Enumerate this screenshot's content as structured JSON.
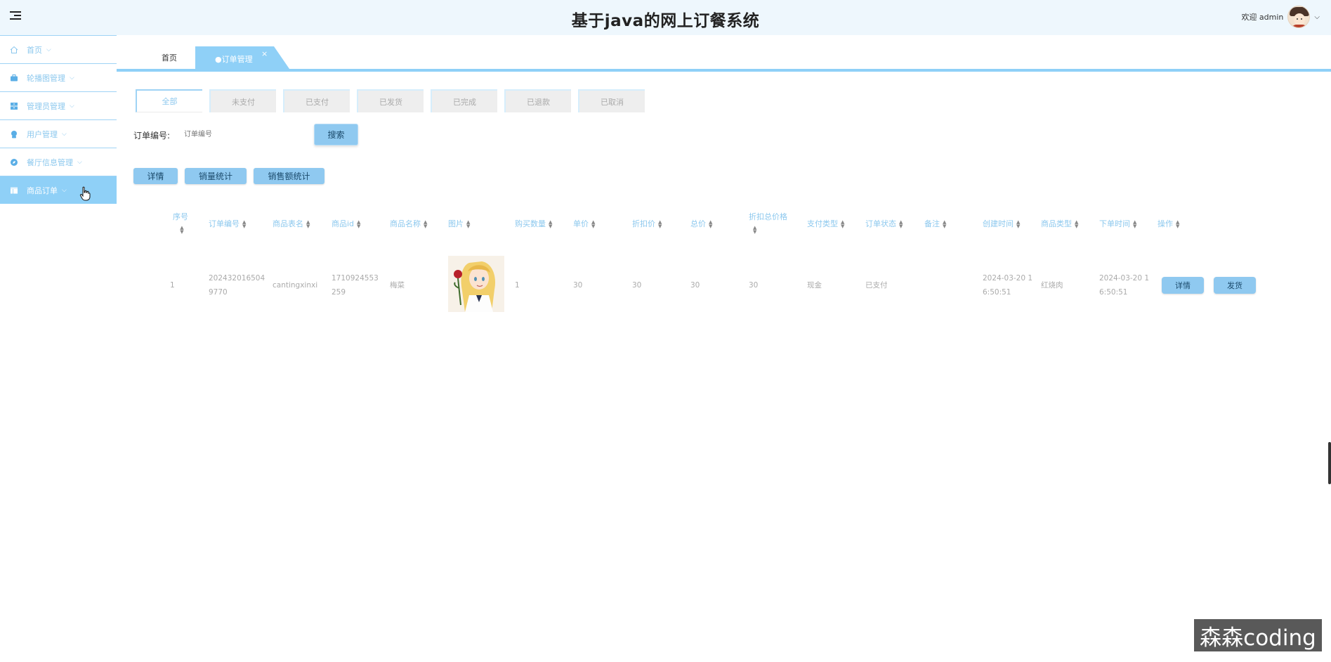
{
  "header": {
    "title": "基于java的网上订餐系统",
    "welcome": "欢迎 admin"
  },
  "sidebar": {
    "items": [
      {
        "label": "首页",
        "icon": "home-icon",
        "active": false
      },
      {
        "label": "轮播图管理",
        "icon": "briefcase-icon",
        "active": false
      },
      {
        "label": "管理员管理",
        "icon": "archive-icon",
        "active": false
      },
      {
        "label": "用户管理",
        "icon": "user-icon",
        "active": false
      },
      {
        "label": "餐厅信息管理",
        "icon": "compass-icon",
        "active": false
      },
      {
        "label": "商品订单",
        "icon": "table-icon",
        "active": true
      }
    ]
  },
  "tabs": {
    "home": "首页",
    "active": "●订单管理",
    "close": "×"
  },
  "status_tabs": [
    "全部",
    "未支付",
    "已支付",
    "已发货",
    "已完成",
    "已退款",
    "已取消"
  ],
  "search": {
    "label": "订单编号:",
    "placeholder": "订单编号",
    "button": "搜索"
  },
  "actions": {
    "detail": "详情",
    "sales_stats": "销量统计",
    "revenue_stats": "销售额统计"
  },
  "table": {
    "headers": [
      "序号",
      "订单编号",
      "商品表名",
      "商品id",
      "商品名称",
      "图片",
      "购买数量",
      "单价",
      "折扣价",
      "总价",
      "折扣总价格",
      "支付类型",
      "订单状态",
      "备注",
      "创建时间",
      "商品类型",
      "下单时间",
      "操作"
    ],
    "rows": [
      {
        "index": "1",
        "order_no_1": "202432016504",
        "order_no_2": "9770",
        "table_name": "cantingxinxi",
        "product_id_1": "1710924553",
        "product_id_2": "259",
        "product_name": "梅菜",
        "quantity": "1",
        "price": "30",
        "discount_price": "30",
        "total": "30",
        "discount_total": "30",
        "pay_type": "现金",
        "status": "已支付",
        "remark": "",
        "created_1": "2024-03-20 1",
        "created_2": "6:50:51",
        "category": "红烧肉",
        "order_time_1": "2024-03-20 1",
        "order_time_2": "6:50:51",
        "btn_detail": "详情",
        "btn_ship": "发货"
      }
    ]
  },
  "watermark": "森森coding",
  "colors": {
    "accent": "#8fd0f7",
    "button": "#8fc9f0",
    "header_bg": "#eef7fd",
    "text_blue": "#8cc8ee"
  }
}
